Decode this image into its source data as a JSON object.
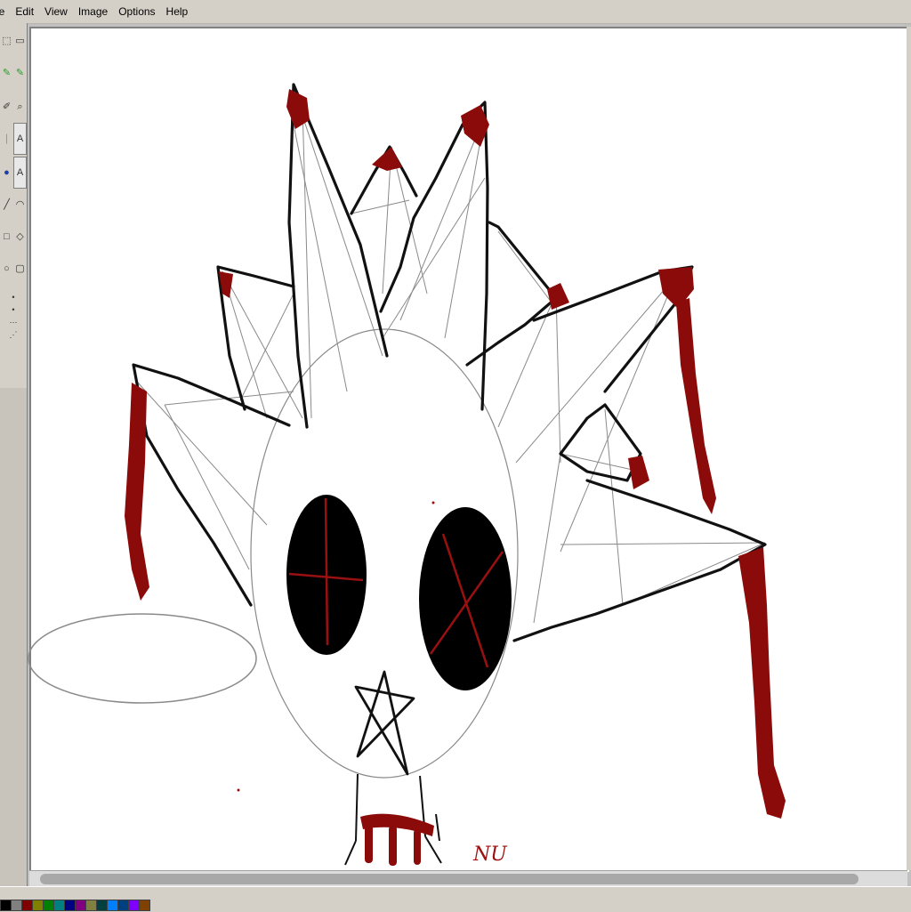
{
  "menu": {
    "items": [
      "le",
      "Edit",
      "View",
      "Image",
      "Options",
      "Help"
    ]
  },
  "toolbox": {
    "tools": [
      "free-select",
      "select",
      "eraser",
      "fill",
      "color-picker",
      "magnifier",
      "pencil",
      "brush",
      "airbrush",
      "text",
      "line",
      "curve",
      "rectangle",
      "polygon",
      "ellipse",
      "rounded-rectangle"
    ],
    "selected_tool": "brush"
  },
  "canvas": {
    "background_color": "#ffffff",
    "stroke_color": "#000000",
    "accent_color": "#8b0000",
    "handwritten_text": "NU"
  },
  "palette": {
    "colors": [
      "#000000",
      "#808080",
      "#800000",
      "#808000",
      "#008000",
      "#008080",
      "#000080",
      "#800080",
      "#808040",
      "#004040",
      "#0080ff",
      "#004080",
      "#8000ff",
      "#804000"
    ]
  }
}
